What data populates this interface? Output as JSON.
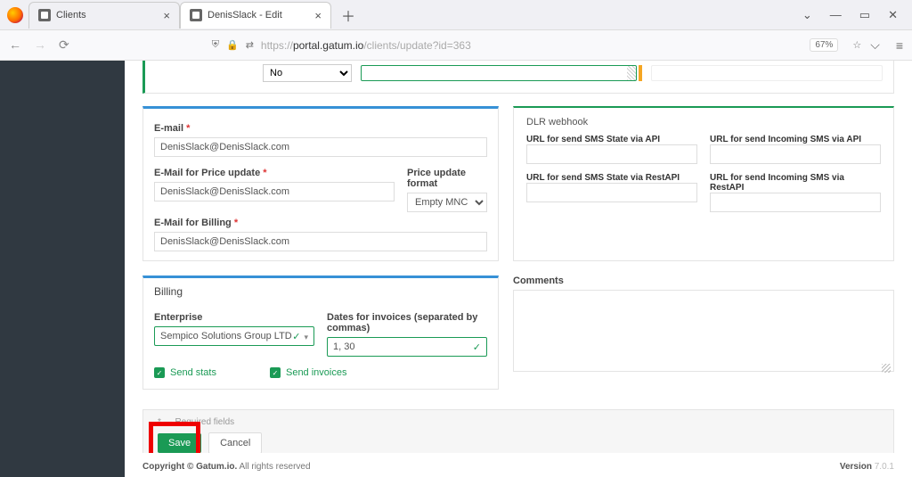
{
  "browser": {
    "tabs": [
      {
        "title": "Clients",
        "active": false
      },
      {
        "title": "DenisSlack - Edit",
        "active": true
      }
    ],
    "url_prefix": "https://",
    "url_host": "portal.gatum.io",
    "url_path": "/clients/update?id=363",
    "zoom": "67%"
  },
  "top_select": "No",
  "email_section": {
    "email_label": "E-mail",
    "email_value": "DenisSlack@DenisSlack.com",
    "price_update_label": "E-Mail for Price update",
    "price_update_value": "DenisSlack@DenisSlack.com",
    "price_format_label": "Price update format",
    "price_format_value": "Empty MNC",
    "billing_label": "E-Mail for Billing",
    "billing_value": "DenisSlack@DenisSlack.com"
  },
  "dlr": {
    "title": "DLR webhook",
    "url_api_state": "URL for send SMS State via API",
    "url_api_incoming": "URL for send Incoming SMS via API",
    "url_rest_state": "URL for send SMS State via RestAPI",
    "url_rest_incoming": "URL for send Incoming SMS via RestAPI"
  },
  "billing": {
    "title": "Billing",
    "enterprise_label": "Enterprise",
    "enterprise_value": "Sempico Solutions Group LTD",
    "dates_label": "Dates for invoices (separated by commas)",
    "dates_value": "1, 30",
    "send_stats": "Send stats",
    "send_invoices": "Send invoices"
  },
  "comments_label": "Comments",
  "actions": {
    "required_note": "* — Required fields",
    "save": "Save",
    "cancel": "Cancel"
  },
  "footer": {
    "copyright_bold": "Copyright © Gatum.io.",
    "copyright_rest": " All rights reserved",
    "version_label": "Version ",
    "version": "7.0.1"
  }
}
